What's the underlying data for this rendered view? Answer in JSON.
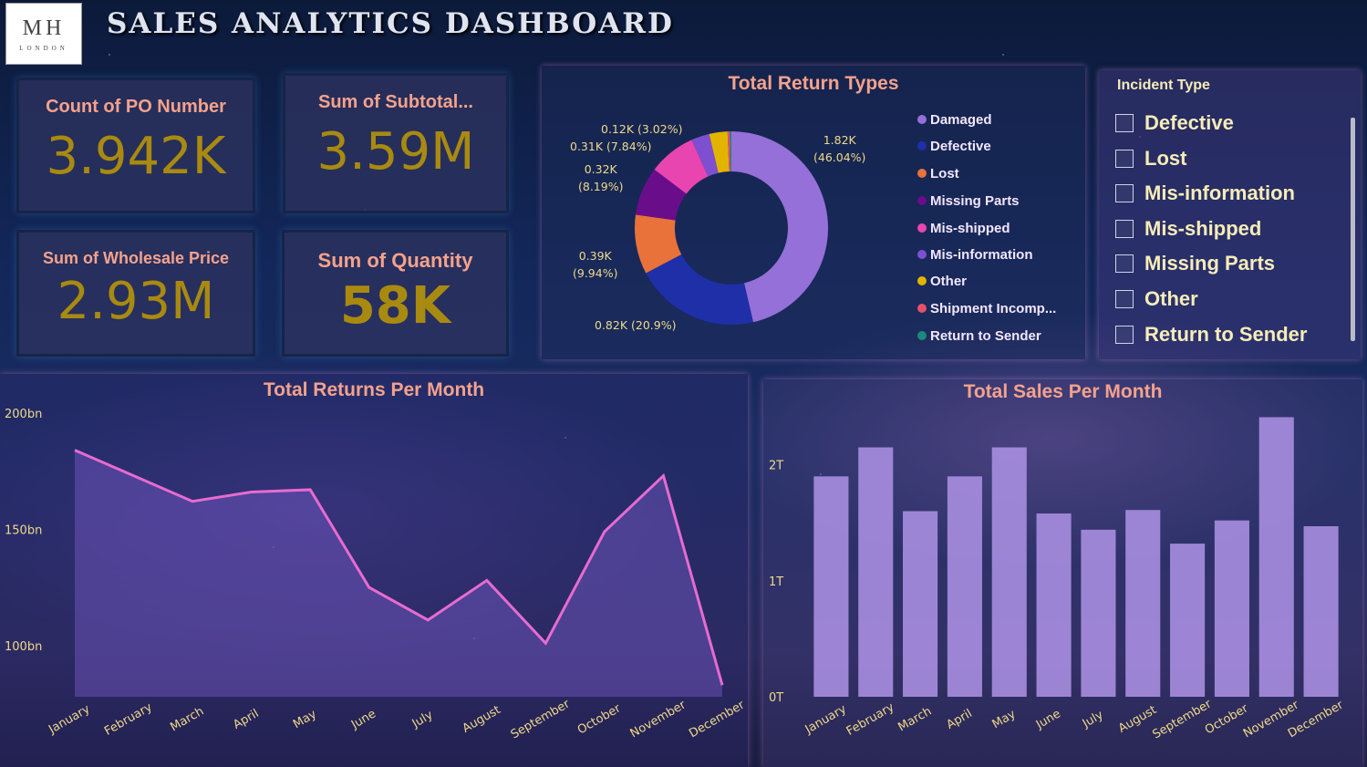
{
  "header": {
    "logo_main": "MH",
    "logo_sub": "LONDON",
    "title": "SALES ANALYTICS DASHBOARD"
  },
  "cards": [
    {
      "label": "Count of PO Number",
      "value": "3.942K"
    },
    {
      "label": "Sum of Subtotal...",
      "value": "3.59M"
    },
    {
      "label": "Sum of Wholesale Price",
      "value": "2.93M"
    },
    {
      "label": "Sum of Quantity",
      "value": "58K"
    }
  ],
  "return_types": {
    "title": "Total Return Types",
    "legend": [
      {
        "name": "Damaged",
        "color": "#9470d8"
      },
      {
        "name": "Defective",
        "color": "#1f2fa8"
      },
      {
        "name": "Lost",
        "color": "#e8723a"
      },
      {
        "name": "Missing Parts",
        "color": "#6a0d8a"
      },
      {
        "name": "Mis-shipped",
        "color": "#e845b0"
      },
      {
        "name": "Mis-information",
        "color": "#7e4fd0"
      },
      {
        "name": "Other",
        "color": "#e2b400"
      },
      {
        "name": "Shipment Incomp...",
        "color": "#e8506a"
      },
      {
        "name": "Return to Sender",
        "color": "#1a8a7a"
      }
    ],
    "data_labels": [
      {
        "line1": "1.82K",
        "line2": "(46.04%)"
      },
      {
        "line1": "0.82K (20.9%)",
        "line2": ""
      },
      {
        "line1": "0.39K",
        "line2": "(9.94%)"
      },
      {
        "line1": "0.32K",
        "line2": "(8.19%)"
      },
      {
        "line1": "0.31K (7.84%)",
        "line2": ""
      },
      {
        "line1": "0.12K (3.02%)",
        "line2": ""
      }
    ]
  },
  "incident_slicer": {
    "title": "Incident Type",
    "items": [
      "Defective",
      "Lost",
      "Mis-information",
      "Mis-shipped",
      "Missing Parts",
      "Other",
      "Return to Sender"
    ]
  },
  "chart_data": [
    {
      "type": "pie",
      "title": "Total Return Types",
      "categories": [
        "Damaged",
        "Defective",
        "Lost",
        "Missing Parts",
        "Mis-shipped",
        "Mis-information",
        "Other",
        "Shipment Incomp...",
        "Return to Sender"
      ],
      "values": [
        1820,
        820,
        390,
        320,
        310,
        120,
        120,
        15,
        10
      ],
      "percent": [
        46.04,
        20.9,
        9.94,
        8.19,
        7.84,
        3.02,
        3.02,
        0.4,
        0.25
      ]
    },
    {
      "type": "area",
      "title": "Total Returns Per Month",
      "categories": [
        "January",
        "February",
        "March",
        "April",
        "May",
        "June",
        "July",
        "August",
        "September",
        "October",
        "November",
        "December"
      ],
      "values": [
        184,
        173,
        162,
        166,
        167,
        125,
        111,
        128,
        101,
        149,
        173,
        83
      ],
      "yunit": "bn",
      "yticks": [
        "200bn",
        "150bn",
        "100bn"
      ],
      "ytick_values": [
        200,
        150,
        100
      ],
      "ylim": [
        78,
        205
      ]
    },
    {
      "type": "bar",
      "title": "Total Sales Per Month",
      "categories": [
        "January",
        "February",
        "March",
        "April",
        "May",
        "June",
        "July",
        "August",
        "September",
        "October",
        "November",
        "December"
      ],
      "values": [
        1.9,
        2.15,
        1.6,
        1.9,
        2.15,
        1.58,
        1.44,
        1.61,
        1.32,
        1.52,
        2.41,
        1.47
      ],
      "yunit": "T",
      "yticks": [
        "2T",
        "1T",
        "0T"
      ],
      "ytick_values": [
        2,
        1,
        0
      ],
      "ylim": [
        0,
        2.5
      ]
    }
  ]
}
